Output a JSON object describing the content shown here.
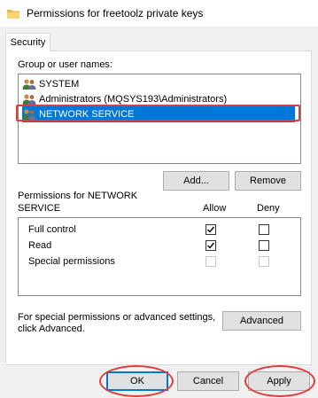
{
  "window": {
    "title": "Permissions for freetoolz private keys"
  },
  "tabs": [
    {
      "label": "Security",
      "active": true
    }
  ],
  "group_section": {
    "label": "Group or user names:",
    "users": [
      {
        "name": "SYSTEM",
        "icon": "users-group-icon",
        "selected": false
      },
      {
        "name": "Administrators (MQSYS193\\Administrators)",
        "icon": "users-group-icon",
        "selected": false
      },
      {
        "name": "NETWORK SERVICE",
        "icon": "users-group-icon",
        "selected": true
      }
    ],
    "add_label": "Add...",
    "remove_label": "Remove"
  },
  "permissions": {
    "header_line1": "Permissions for NETWORK",
    "header_line2": "SERVICE",
    "allow_label": "Allow",
    "deny_label": "Deny",
    "rows": [
      {
        "name": "Full control",
        "allow": true,
        "deny": false,
        "enabled": true
      },
      {
        "name": "Read",
        "allow": true,
        "deny": false,
        "enabled": true
      },
      {
        "name": "Special permissions",
        "allow": false,
        "deny": false,
        "enabled": false
      }
    ]
  },
  "advanced": {
    "text_line1": "For special permissions or advanced settings,",
    "text_line2": "click Advanced.",
    "button_label": "Advanced"
  },
  "footer": {
    "ok_label": "OK",
    "cancel_label": "Cancel",
    "apply_label": "Apply"
  },
  "colors": {
    "selection": "#0078d7",
    "highlight_annotation": "#e03c3c",
    "panel_background": "#ffffff",
    "window_background": "#f0f0f0"
  }
}
